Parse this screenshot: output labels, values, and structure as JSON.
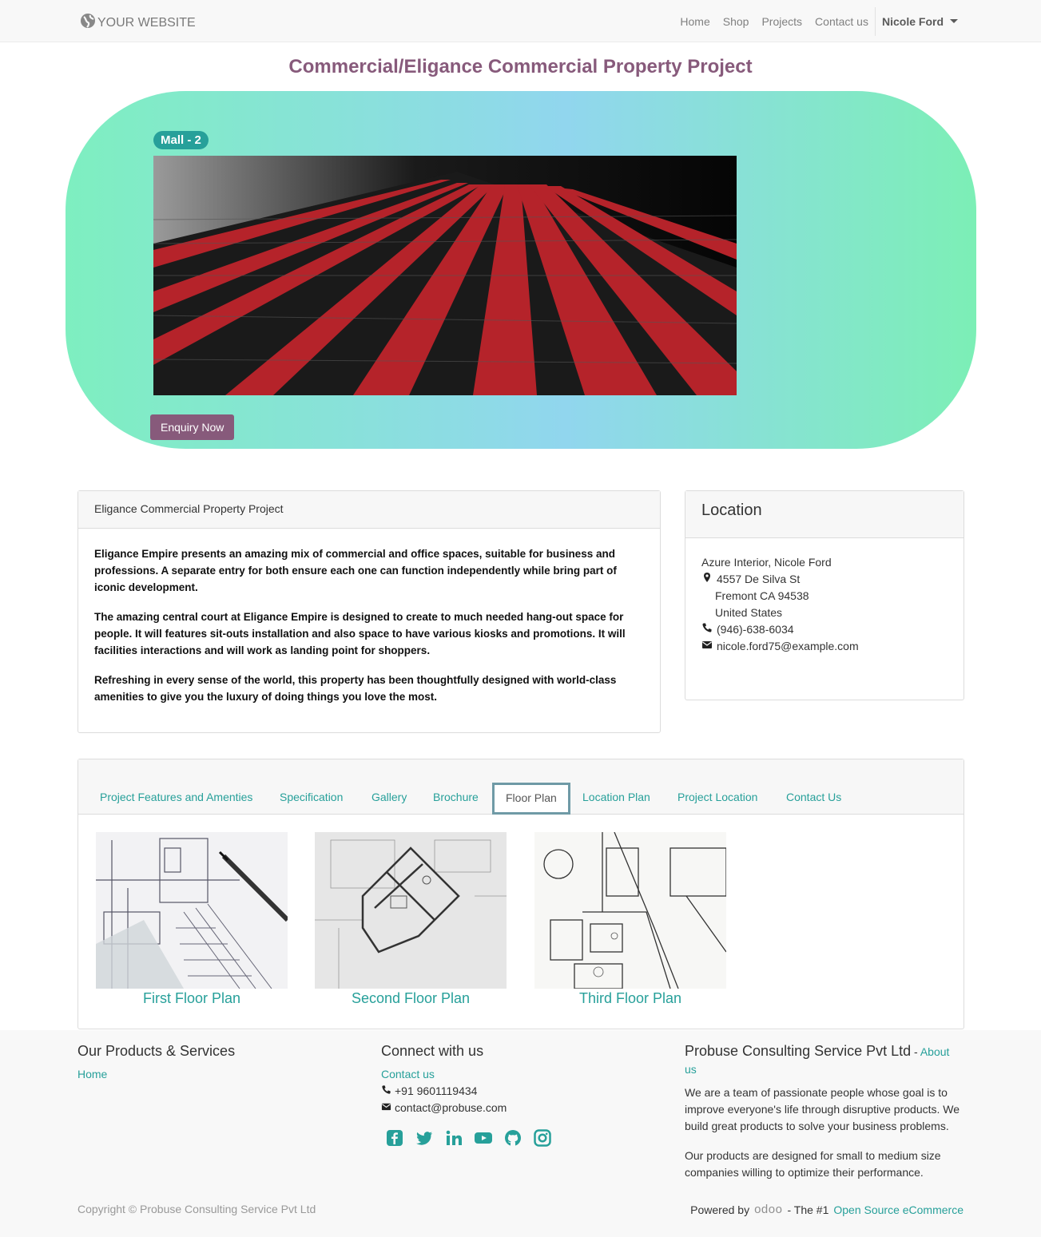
{
  "navbar": {
    "brand": "YOUR WEBSITE",
    "links": [
      "Home",
      "Shop",
      "Projects",
      "Contact us"
    ],
    "user": "Nicole Ford"
  },
  "page_title": "Commercial/Eligance Commercial Property Project",
  "hero": {
    "badge": "Mall - 2",
    "button": "Enquiry Now"
  },
  "description": {
    "header": "Eligance Commercial Property Project",
    "paragraphs": [
      "Eligance Empire presents an amazing mix of commercial and office spaces, suitable for business and professions. A separate entry for both ensure each one can function independently while bring part of iconic development.",
      "The amazing central court at Eligance Empire is designed to create to much needed hang-out space for people. It will features sit-outs installation and also space to have various kiosks and promotions. It will facilities interactions and will work as landing point for shoppers.",
      "Refreshing in every sense of the world, this property has been thoughtfully designed with world-class amenities to give you the luxury of doing things you love the most."
    ]
  },
  "location": {
    "title": "Location",
    "name": "Azure Interior, Nicole Ford",
    "street": "4557 De Silva St",
    "city": "Fremont CA 94538",
    "country": "United States",
    "phone": "(946)-638-6034",
    "email": "nicole.ford75@example.com"
  },
  "tabs": [
    "Project Features and Amenties",
    "Specification",
    "Gallery",
    "Brochure",
    "Floor Plan",
    "Location Plan",
    "Project Location",
    "Contact Us"
  ],
  "active_tab": "Floor Plan",
  "floor_plans": [
    "First Floor Plan",
    "Second Floor Plan",
    "Third Floor Plan"
  ],
  "footer": {
    "products": {
      "title": "Our Products & Services",
      "link": "Home"
    },
    "connect": {
      "title": "Connect with us",
      "link": "Contact us",
      "phone": "+91 9601119434",
      "email": "contact@probuse.com",
      "social": [
        "facebook-icon",
        "twitter-icon",
        "linkedin-icon",
        "youtube-icon",
        "github-icon",
        "instagram-icon"
      ]
    },
    "company": {
      "title": "Probuse Consulting Service Pvt Ltd",
      "sep": " - ",
      "about": "About us",
      "p1": "We are a team of passionate people whose goal is to improve everyone's life through disruptive products. We build great products to solve your business problems.",
      "p2": "Our products are designed for small to medium size companies willing to optimize their performance."
    },
    "copyright": "Copyright © Probuse Consulting Service Pvt Ltd",
    "powered_by": "Powered by",
    "odoo": "odoo",
    "tagline": "- The #1",
    "tagline_link": "Open Source eCommerce"
  },
  "colors": {
    "brand": "#875a7b",
    "accent": "#27a09a",
    "badge": "#27a09a"
  }
}
